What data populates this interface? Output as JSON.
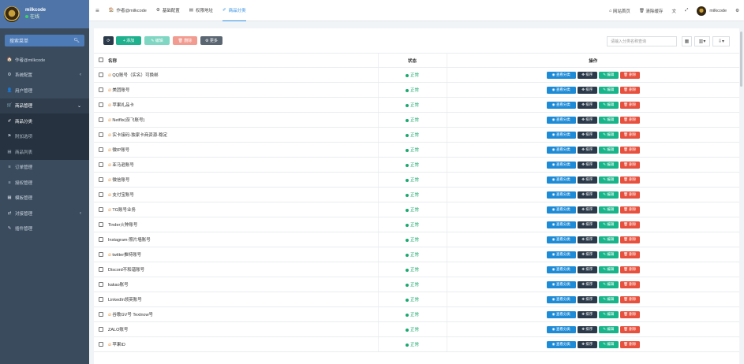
{
  "sidebar": {
    "brand_name": "milkcode",
    "brand_status": "在线",
    "search_placeholder": "搜索菜单",
    "items": [
      {
        "label": "作者@milkcode",
        "icon": "🏠",
        "chev": "",
        "state": ""
      },
      {
        "label": "系统配置",
        "icon": "⚙",
        "chev": "‹",
        "state": ""
      },
      {
        "label": "用户管理",
        "icon": "👤",
        "chev": "",
        "state": ""
      },
      {
        "label": "商品管理",
        "icon": "🛒",
        "chev": "⌄",
        "state": "active-group"
      },
      {
        "label": "商品分类",
        "icon": "✐",
        "chev": "",
        "state": "current"
      },
      {
        "label": "附加选项",
        "icon": "⚑",
        "chev": "",
        "state": "sub"
      },
      {
        "label": "商品列表",
        "icon": "▤",
        "chev": "",
        "state": "sub"
      },
      {
        "label": "订单管理",
        "icon": "≡",
        "chev": "",
        "state": ""
      },
      {
        "label": "授权管理",
        "icon": "≡",
        "chev": "",
        "state": ""
      },
      {
        "label": "模板管理",
        "icon": "▦",
        "chev": "",
        "state": ""
      },
      {
        "label": "对接管理",
        "icon": "⇄",
        "chev": "‹",
        "state": ""
      },
      {
        "label": "插件管理",
        "icon": "✎",
        "chev": "",
        "state": ""
      }
    ]
  },
  "topbar": {
    "tabs": [
      {
        "icon": "🏠",
        "label": "作者@milkcode",
        "active": false
      },
      {
        "icon": "⚙",
        "label": "基础配置",
        "active": false
      },
      {
        "icon": "▤",
        "label": "权限地址",
        "active": false
      },
      {
        "icon": "✐",
        "label": "商品分类",
        "active": true
      }
    ],
    "right": {
      "home_label": "网站首页",
      "cache_label": "清除缓存",
      "user": "milkcode"
    }
  },
  "toolbar": {
    "add_label": "添加",
    "edit_label": "编辑",
    "delete_label": "删除",
    "more_label": "更多",
    "search_placeholder": "请输入分类名称查询"
  },
  "table": {
    "headers": {
      "name": "名称",
      "status": "状态",
      "ops": "操作"
    },
    "op_labels": {
      "view": "查看分类",
      "sort": "排序",
      "edit": "编辑",
      "delete": "删除"
    },
    "rows": [
      {
        "name": "QQ账号（实名）可换绑",
        "fire": true,
        "status": "正常"
      },
      {
        "name": "美团账号",
        "fire": true,
        "status": "正常"
      },
      {
        "name": "苹果礼品卡",
        "fire": true,
        "status": "正常"
      },
      {
        "name": "Netflix(奈飞账号)",
        "fire": true,
        "status": "正常"
      },
      {
        "name": "实卡接码-独家卡商资源-稳定",
        "fire": true,
        "status": "正常"
      },
      {
        "name": "微IP账号",
        "fire": true,
        "status": "正常"
      },
      {
        "name": "亚马逊账号",
        "fire": true,
        "status": "正常"
      },
      {
        "name": "微信账号",
        "fire": true,
        "status": "正常"
      },
      {
        "name": "支付宝账号",
        "fire": true,
        "status": "正常"
      },
      {
        "name": "TG账号业务",
        "fire": true,
        "status": "正常"
      },
      {
        "name": "Tinder火种账号",
        "fire": false,
        "status": "正常"
      },
      {
        "name": "Instagram-照片墙账号",
        "fire": false,
        "status": "正常"
      },
      {
        "name": "twitter推特账号",
        "fire": true,
        "status": "正常"
      },
      {
        "name": "Discord不和谐账号",
        "fire": false,
        "status": "正常"
      },
      {
        "name": "kakao账号",
        "fire": false,
        "status": "正常"
      },
      {
        "name": "LinkedIn领英账号",
        "fire": false,
        "status": "正常"
      },
      {
        "name": "谷歌GV号 Textnow号",
        "fire": true,
        "status": "正常"
      },
      {
        "name": "ZALO账号",
        "fire": false,
        "status": "正常"
      },
      {
        "name": "苹果ID",
        "fire": true,
        "status": "正常"
      }
    ]
  }
}
